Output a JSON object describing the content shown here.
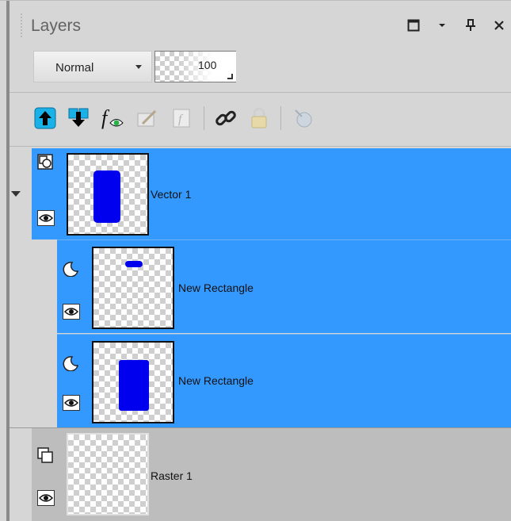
{
  "panel": {
    "title": "Layers",
    "window_controls": [
      "maximize-icon",
      "dropdown-icon",
      "pin-icon",
      "close-icon"
    ]
  },
  "blend": {
    "mode": "Normal",
    "opacity": "100"
  },
  "toolbar": {
    "tools": [
      {
        "name": "move-layer-up-icon",
        "enabled": true
      },
      {
        "name": "move-layer-down-icon",
        "enabled": true
      },
      {
        "name": "layer-effects-icon",
        "enabled": true
      },
      {
        "name": "edit-selection-icon",
        "enabled": false
      },
      {
        "name": "mask-icon",
        "enabled": false
      },
      {
        "name": "link-icon",
        "enabled": true
      },
      {
        "name": "lock-icon",
        "enabled": false
      },
      {
        "name": "highlight-icon",
        "enabled": false
      }
    ]
  },
  "layers": [
    {
      "name": "Vector 1",
      "type": "vector",
      "selected": true,
      "expanded": true
    },
    {
      "name": "New Rectangle",
      "type": "vector-object",
      "selected": true
    },
    {
      "name": "New Rectangle",
      "type": "vector-object",
      "selected": true
    },
    {
      "name": "Raster 1",
      "type": "raster",
      "selected": false
    }
  ],
  "colors": {
    "selection": "#3399ff",
    "panel_bg": "#d6d6d6",
    "shape_fill": "#0000ee"
  }
}
